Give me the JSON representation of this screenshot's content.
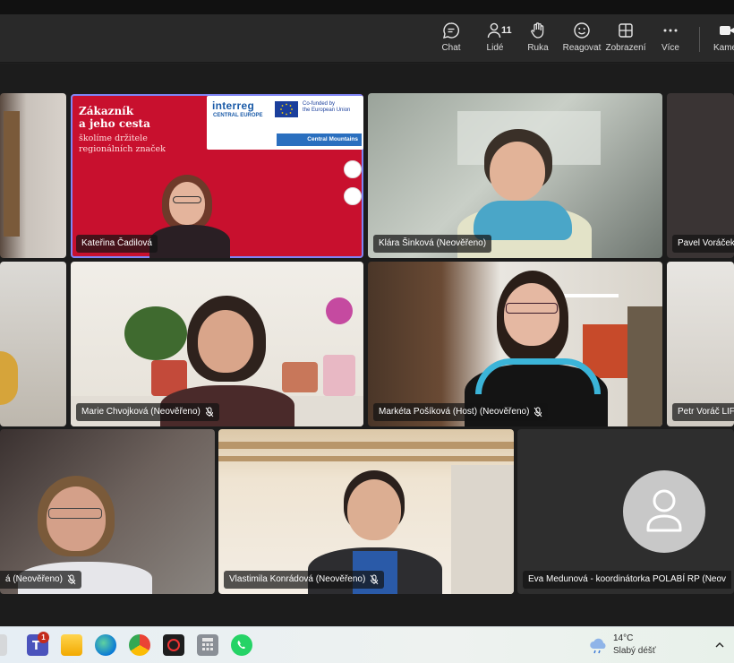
{
  "toolbar": {
    "chat_label": "Chat",
    "people_label": "Lidé",
    "people_count": "11",
    "hand_label": "Ruka",
    "react_label": "Reagovat",
    "view_label": "Zobrazení",
    "more_label": "Více",
    "camera_label": "Kame"
  },
  "slide": {
    "title_line1": "Zákazník",
    "title_line2": "a jeho cesta",
    "subtitle_line1": "školíme držitele",
    "subtitle_line2": "regionálních značek",
    "interreg": "interreg",
    "central_europe": "CENTRAL EUROPE",
    "cofunded_line1": "Co-funded by",
    "cofunded_line2": "the European Union",
    "program": "Central Mountains"
  },
  "participants": [
    {
      "name": "Kateřina Čadilová"
    },
    {
      "name": "Klára Šinková (Neověřeno)"
    },
    {
      "name": "Pavel Voráček"
    },
    {
      "name": "Marie Chvojková (Neověřeno)"
    },
    {
      "name": "Markéta Pošíková (Host) (Neověřeno)"
    },
    {
      "name": "Petr Voráč LIFE"
    },
    {
      "name": "á (Neověřeno)"
    },
    {
      "name": "Vlastimila Konrádová (Neověřeno)"
    },
    {
      "name": "Eva Medunová - koordinátorka POLABÍ RP (Neov"
    }
  ],
  "taskbar": {
    "teams_badge": "1",
    "temperature": "14°C",
    "weather": "Slabý déšť"
  },
  "colors": {
    "accent": "#7f85f5",
    "slide_red": "#c8102e",
    "interreg_blue": "#1b5ba8"
  }
}
